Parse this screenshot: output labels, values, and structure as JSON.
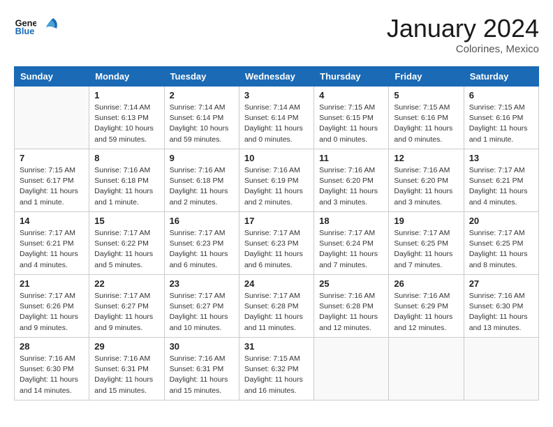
{
  "header": {
    "logo_general": "General",
    "logo_blue": "Blue",
    "month_title": "January 2024",
    "location": "Colorines, Mexico"
  },
  "weekdays": [
    "Sunday",
    "Monday",
    "Tuesday",
    "Wednesday",
    "Thursday",
    "Friday",
    "Saturday"
  ],
  "weeks": [
    [
      {
        "day": "",
        "detail": ""
      },
      {
        "day": "1",
        "detail": "Sunrise: 7:14 AM\nSunset: 6:13 PM\nDaylight: 10 hours\nand 59 minutes."
      },
      {
        "day": "2",
        "detail": "Sunrise: 7:14 AM\nSunset: 6:14 PM\nDaylight: 10 hours\nand 59 minutes."
      },
      {
        "day": "3",
        "detail": "Sunrise: 7:14 AM\nSunset: 6:14 PM\nDaylight: 11 hours\nand 0 minutes."
      },
      {
        "day": "4",
        "detail": "Sunrise: 7:15 AM\nSunset: 6:15 PM\nDaylight: 11 hours\nand 0 minutes."
      },
      {
        "day": "5",
        "detail": "Sunrise: 7:15 AM\nSunset: 6:16 PM\nDaylight: 11 hours\nand 0 minutes."
      },
      {
        "day": "6",
        "detail": "Sunrise: 7:15 AM\nSunset: 6:16 PM\nDaylight: 11 hours\nand 1 minute."
      }
    ],
    [
      {
        "day": "7",
        "detail": "Sunrise: 7:15 AM\nSunset: 6:17 PM\nDaylight: 11 hours\nand 1 minute."
      },
      {
        "day": "8",
        "detail": "Sunrise: 7:16 AM\nSunset: 6:18 PM\nDaylight: 11 hours\nand 1 minute."
      },
      {
        "day": "9",
        "detail": "Sunrise: 7:16 AM\nSunset: 6:18 PM\nDaylight: 11 hours\nand 2 minutes."
      },
      {
        "day": "10",
        "detail": "Sunrise: 7:16 AM\nSunset: 6:19 PM\nDaylight: 11 hours\nand 2 minutes."
      },
      {
        "day": "11",
        "detail": "Sunrise: 7:16 AM\nSunset: 6:20 PM\nDaylight: 11 hours\nand 3 minutes."
      },
      {
        "day": "12",
        "detail": "Sunrise: 7:16 AM\nSunset: 6:20 PM\nDaylight: 11 hours\nand 3 minutes."
      },
      {
        "day": "13",
        "detail": "Sunrise: 7:17 AM\nSunset: 6:21 PM\nDaylight: 11 hours\nand 4 minutes."
      }
    ],
    [
      {
        "day": "14",
        "detail": "Sunrise: 7:17 AM\nSunset: 6:21 PM\nDaylight: 11 hours\nand 4 minutes."
      },
      {
        "day": "15",
        "detail": "Sunrise: 7:17 AM\nSunset: 6:22 PM\nDaylight: 11 hours\nand 5 minutes."
      },
      {
        "day": "16",
        "detail": "Sunrise: 7:17 AM\nSunset: 6:23 PM\nDaylight: 11 hours\nand 6 minutes."
      },
      {
        "day": "17",
        "detail": "Sunrise: 7:17 AM\nSunset: 6:23 PM\nDaylight: 11 hours\nand 6 minutes."
      },
      {
        "day": "18",
        "detail": "Sunrise: 7:17 AM\nSunset: 6:24 PM\nDaylight: 11 hours\nand 7 minutes."
      },
      {
        "day": "19",
        "detail": "Sunrise: 7:17 AM\nSunset: 6:25 PM\nDaylight: 11 hours\nand 7 minutes."
      },
      {
        "day": "20",
        "detail": "Sunrise: 7:17 AM\nSunset: 6:25 PM\nDaylight: 11 hours\nand 8 minutes."
      }
    ],
    [
      {
        "day": "21",
        "detail": "Sunrise: 7:17 AM\nSunset: 6:26 PM\nDaylight: 11 hours\nand 9 minutes."
      },
      {
        "day": "22",
        "detail": "Sunrise: 7:17 AM\nSunset: 6:27 PM\nDaylight: 11 hours\nand 9 minutes."
      },
      {
        "day": "23",
        "detail": "Sunrise: 7:17 AM\nSunset: 6:27 PM\nDaylight: 11 hours\nand 10 minutes."
      },
      {
        "day": "24",
        "detail": "Sunrise: 7:17 AM\nSunset: 6:28 PM\nDaylight: 11 hours\nand 11 minutes."
      },
      {
        "day": "25",
        "detail": "Sunrise: 7:16 AM\nSunset: 6:28 PM\nDaylight: 11 hours\nand 12 minutes."
      },
      {
        "day": "26",
        "detail": "Sunrise: 7:16 AM\nSunset: 6:29 PM\nDaylight: 11 hours\nand 12 minutes."
      },
      {
        "day": "27",
        "detail": "Sunrise: 7:16 AM\nSunset: 6:30 PM\nDaylight: 11 hours\nand 13 minutes."
      }
    ],
    [
      {
        "day": "28",
        "detail": "Sunrise: 7:16 AM\nSunset: 6:30 PM\nDaylight: 11 hours\nand 14 minutes."
      },
      {
        "day": "29",
        "detail": "Sunrise: 7:16 AM\nSunset: 6:31 PM\nDaylight: 11 hours\nand 15 minutes."
      },
      {
        "day": "30",
        "detail": "Sunrise: 7:16 AM\nSunset: 6:31 PM\nDaylight: 11 hours\nand 15 minutes."
      },
      {
        "day": "31",
        "detail": "Sunrise: 7:15 AM\nSunset: 6:32 PM\nDaylight: 11 hours\nand 16 minutes."
      },
      {
        "day": "",
        "detail": ""
      },
      {
        "day": "",
        "detail": ""
      },
      {
        "day": "",
        "detail": ""
      }
    ]
  ]
}
